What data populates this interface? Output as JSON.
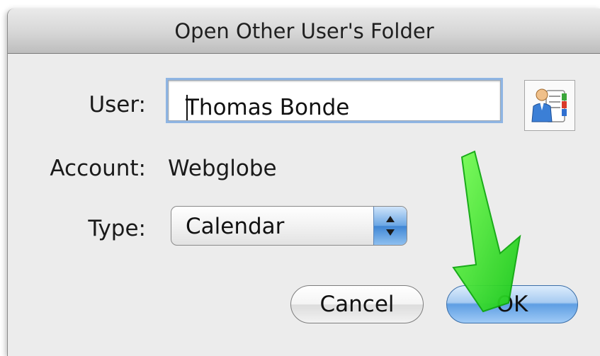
{
  "dialog": {
    "title": "Open Other User's Folder",
    "user_label": "User:",
    "user_value": "Thomas Bonde",
    "address_book_icon": "address-book-icon",
    "account_label": "Account:",
    "account_value": "Webglobe",
    "type_label": "Type:",
    "type_value": "Calendar",
    "cancel_label": "Cancel",
    "ok_label": "OK"
  },
  "annotation": {
    "arrow_icon": "green-arrow-icon",
    "arrow_color": "#2fe02f"
  },
  "colors": {
    "dialog_bg": "#ececec",
    "focus_ring": "#8fb5e3",
    "default_button": "#5e9ee3"
  }
}
